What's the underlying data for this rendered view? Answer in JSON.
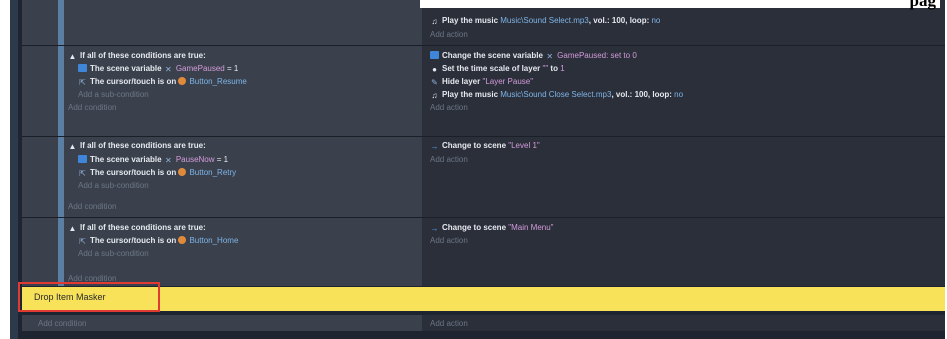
{
  "heading_fragment": "pag",
  "events": [
    {
      "conditions_header": "",
      "conditions": [],
      "actions": [
        {
          "icon": "music-icon",
          "label": "Play the music",
          "value": "Music\\Sound Select.mp3",
          "suffix1": ", vol.:",
          "vol": "100",
          "suffix2": ", loop:",
          "loop": "no"
        }
      ],
      "add_action": "Add action"
    },
    {
      "conditions_header": "If all of these conditions are true:",
      "conditions": [
        {
          "icon": "variable-icon",
          "label": "The scene variable",
          "var": "GamePaused",
          "op": "= 1"
        },
        {
          "icon": "cursor-icon",
          "label": "The cursor/touch is on",
          "obj": "Button_Resume"
        }
      ],
      "add_sub_condition": "Add a sub-condition",
      "add_condition": "Add condition",
      "actions": [
        {
          "icon": "variable-icon",
          "label": "Change the scene variable",
          "var": "GamePaused",
          "op": ": set to",
          "val": "0"
        },
        {
          "icon": "gear-icon",
          "label": "Set the time scale of layer",
          "layer": "\"\"",
          "to": "to",
          "val": "1"
        },
        {
          "icon": "pencil-icon",
          "label": "Hide layer",
          "layer": "\"Layer Pause\""
        },
        {
          "icon": "music-icon",
          "label": "Play the music",
          "value": "Music\\Sound Close Select.mp3",
          "suffix1": ", vol.:",
          "vol": "100",
          "suffix2": ", loop:",
          "loop": "no"
        }
      ],
      "add_action": "Add action"
    },
    {
      "conditions_header": "If all of these conditions are true:",
      "conditions": [
        {
          "icon": "variable-icon",
          "label": "The scene variable",
          "var": "PauseNow",
          "op": "= 1"
        },
        {
          "icon": "cursor-icon",
          "label": "The cursor/touch is on",
          "obj": "Button_Retry"
        }
      ],
      "add_sub_condition": "Add a sub-condition",
      "add_condition": "Add condition",
      "actions": [
        {
          "icon": "arrow-icon",
          "label": "Change to scene",
          "scene": "\"Level 1\""
        }
      ],
      "add_action": "Add action"
    },
    {
      "conditions_header": "If all of these conditions are true:",
      "conditions": [
        {
          "icon": "cursor-icon",
          "label": "The cursor/touch is on",
          "obj": "Button_Home"
        }
      ],
      "add_sub_condition": "Add a sub-condition",
      "add_condition": "Add condition",
      "actions": [
        {
          "icon": "arrow-icon",
          "label": "Change to scene",
          "scene": "\"Main Menu\""
        }
      ],
      "add_action": "Add action"
    }
  ],
  "comment": {
    "text": "Drop Item Masker",
    "color": "#f7e25a"
  },
  "bottom": {
    "add_condition": "Add condition",
    "add_action": "Add action"
  },
  "colors": {
    "editor_bg": "#1e2430",
    "condition_bg": "#3a414d",
    "action_bg": "#2a2f3a",
    "link": "#7fb4e6",
    "highlight": "#e13a32"
  }
}
